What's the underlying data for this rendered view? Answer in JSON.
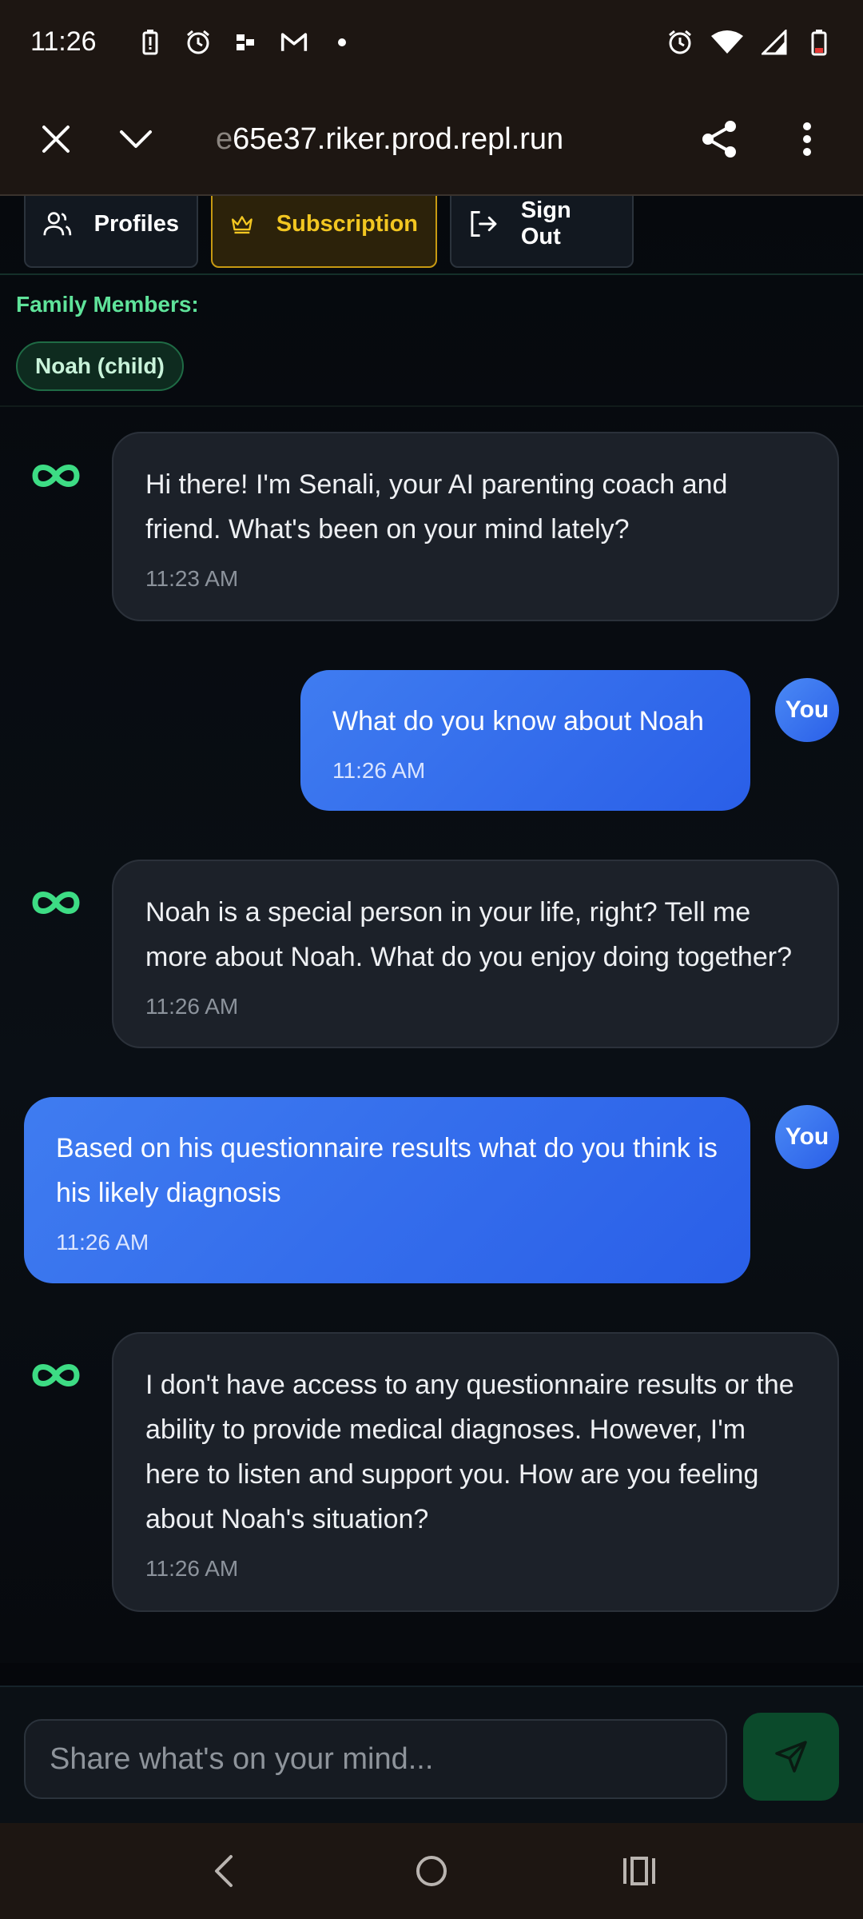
{
  "status_bar": {
    "time": "11:26",
    "left_icons": [
      "battery-alert-icon",
      "alarm-icon",
      "tasks-icon",
      "gmail-icon",
      "dot-icon"
    ],
    "right_icons": [
      "alarm-icon",
      "wifi-icon",
      "signal-icon",
      "battery-low-icon"
    ]
  },
  "browser": {
    "url_faded": "e",
    "url": "65e37.riker.prod.repl.run",
    "close_icon": "close-icon",
    "tabs_icon": "chevron-down-icon",
    "share_icon": "share-icon",
    "menu_icon": "more-vert-icon"
  },
  "header": {
    "profiles_label": "Profiles",
    "subscription_label": "Subscription",
    "signout_label": "Sign Out"
  },
  "family": {
    "label": "Family Members:",
    "members": [
      "Noah (child)"
    ]
  },
  "messages": [
    {
      "role": "ai",
      "text": "Hi there! I'm Senali, your AI parenting coach and friend. What's been on your mind lately?",
      "time": "11:23 AM"
    },
    {
      "role": "user",
      "text": "What do you know about Noah",
      "time": "11:26 AM",
      "badge": "You"
    },
    {
      "role": "ai",
      "text": "Noah is a special person in your life, right? Tell me more about Noah. What do you enjoy doing together?",
      "time": "11:26 AM"
    },
    {
      "role": "user",
      "text": "Based on his questionnaire results what do you think is his likely diagnosis",
      "time": "11:26 AM",
      "badge": "You"
    },
    {
      "role": "ai",
      "text": "I don't have access to any questionnaire results or the ability to provide medical diagnoses. However, I'm here to listen and support you. How are you feeling about Noah's situation?",
      "time": "11:26 AM"
    }
  ],
  "composer": {
    "placeholder": "Share what's on your mind...",
    "value": ""
  },
  "colors": {
    "accent_green": "#5fe39a",
    "user_bubble": "#2a5fe8",
    "ai_bubble": "#1c2129",
    "subscription_gold": "#f2c621"
  }
}
